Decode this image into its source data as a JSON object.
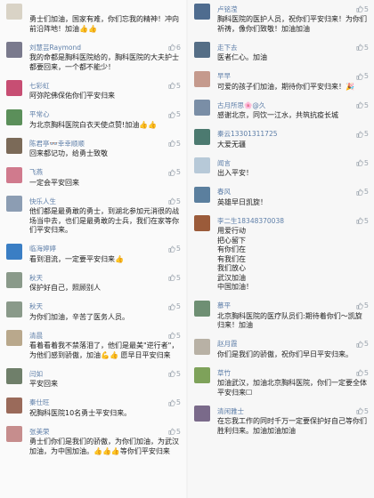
{
  "left": [
    {
      "name": "",
      "avatar": "#d9d3c6",
      "likes": "",
      "text": "勇士们加油，国家有难，你们忘我的精神！冲向前沿阵地！加油👍👍"
    },
    {
      "name": "刘慧芸Raymond",
      "avatar": "#7a7a8d",
      "likes": "6",
      "text": "我的命都是胸科医院给的，胸科医院的大夫护士都要回来，一个都不能少！"
    },
    {
      "name": "七彩虹",
      "avatar": "#c74e73",
      "likes": "5",
      "text": "阿弥陀佛保佑你们平安归来"
    },
    {
      "name": "平常心",
      "avatar": "#5b8f5a",
      "likes": "5",
      "text": "为北京胸科医院白衣天使点赞!加油👍👍"
    },
    {
      "name": "陈君亭👓幸幸顺顺",
      "avatar": "#7b6a58",
      "likes": "5",
      "text": "回来都记功，给勇士致敬"
    },
    {
      "name": "飞燕",
      "avatar": "#d07a8d",
      "likes": "5",
      "text": "一定会平安回来"
    },
    {
      "name": "快乐人生",
      "avatar": "#8c9db3",
      "likes": "5",
      "text": "他们都是最勇敢的勇士，到湖北参加元消很的战场当中去，也们是最勇敢的士兵，我们在家等你们平安归来。"
    },
    {
      "name": "临海婷婷",
      "avatar": "#3a7ec4",
      "likes": "5",
      "text": "看到泪流，一定要平安归来👍"
    },
    {
      "name": "秋天",
      "avatar": "#8a9a8a",
      "likes": "5",
      "text": "保护好自己，照顾别人"
    },
    {
      "name": "秋天",
      "avatar": "#8a9a8a",
      "likes": "5",
      "text": "为你们加油，辛苦了医务人员。"
    },
    {
      "name": "清晨",
      "avatar": "#b9a88c",
      "likes": "5",
      "text": "看着看着我不禁落泪了，他们是最美\"逆行者\"，为他们感到骄傲，加油💪👍 愿早日平安归来"
    },
    {
      "name": "闫如",
      "avatar": "#6f7f6a",
      "likes": "5",
      "text": "平安回来"
    },
    {
      "name": "秦仕旺",
      "avatar": "#9a6a5a",
      "likes": "5",
      "text": "祝胸科医院10名勇士平安归来。"
    },
    {
      "name": "张美荣",
      "avatar": "#c68d8d",
      "likes": "5",
      "text": "勇士们你们是我们的骄傲，为你们加油，为武汉加油，为中国加油。👍👍👍等你们平安归来"
    }
  ],
  "right": [
    {
      "name": "卢铭滢",
      "avatar": "#4f6c8f",
      "likes": "5",
      "text": "胸科医院的医护人员，祝你们平安归来！为你们祈祷，像你们致敬！加油加油"
    },
    {
      "name": "走下去",
      "avatar": "#556e86",
      "likes": "5",
      "text": "医者仁心。加油"
    },
    {
      "name": "早早",
      "avatar": "#c59a8d",
      "likes": "5",
      "text": "可爱的孩子们加油，期待你们平安归来！🎉"
    },
    {
      "name": "古月所思🌸@久",
      "avatar": "#7a8ea6",
      "likes": "5",
      "text": "感谢北京，同饮一江水，共筑抗疫长城"
    },
    {
      "name": "秦云13301311725",
      "avatar": "#4c7a70",
      "likes": "5",
      "text": "大爱无疆"
    },
    {
      "name": "闻言",
      "avatar": "#b7c9d8",
      "likes": "5",
      "text": "出入平安！"
    },
    {
      "name": "春风",
      "avatar": "#5b7f9e",
      "likes": "5",
      "text": "英雄早日凯旋！"
    },
    {
      "name": "李二生18348370038",
      "avatar": "#9b5b3a",
      "likes": "5",
      "text": "用爱行动\n把心留下\n有你们在\n有我们在\n我们放心\n武汉加油\n中国加油！"
    },
    {
      "name": "慕平",
      "avatar": "#6e8f73",
      "likes": "5",
      "text": "北京胸科医院的医疗队员们:期待着你们～凯旋归来！加油"
    },
    {
      "name": "赵月霞",
      "avatar": "#b8b1a5",
      "likes": "5",
      "text": "你们是我们的骄傲，祝你们早日平安归来。"
    },
    {
      "name": "草竹",
      "avatar": "#7ea25a",
      "likes": "5",
      "text": "加油武汉，加油北京胸科医院，你们一定要全体平安归来☐"
    },
    {
      "name": "清闲雅士",
      "avatar": "#7a6a8a",
      "likes": "5",
      "text": "在忘我工作的同时千万一定要保护好自己等你们胜利归来。加油加油加油"
    }
  ]
}
